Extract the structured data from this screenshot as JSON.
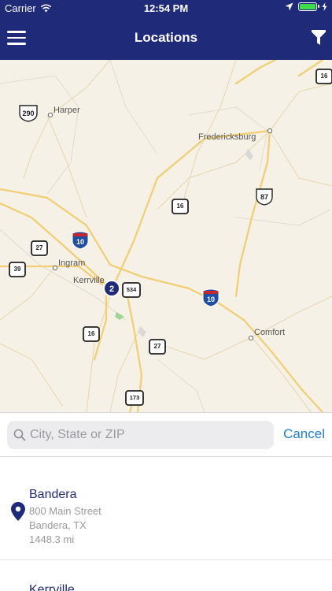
{
  "status_bar": {
    "carrier": "Carrier",
    "time": "12:54 PM"
  },
  "nav": {
    "title": "Locations",
    "menu_icon": "hamburger-menu-icon",
    "filter_icon": "filter-funnel-icon"
  },
  "map": {
    "places": [
      "Harper",
      "Fredericksburg",
      "Ingram",
      "Kerrville",
      "Comfort"
    ],
    "cluster_count": "2",
    "shields": [
      "290",
      "16",
      "16",
      "87",
      "27",
      "10",
      "39",
      "534",
      "10",
      "16",
      "27",
      "173"
    ]
  },
  "search": {
    "placeholder": "City, State or ZIP",
    "value": "",
    "cancel_label": "Cancel"
  },
  "results": [
    {
      "name": "Bandera",
      "address": "800 Main Street",
      "city_state": "Bandera, TX",
      "distance": "1448.3 mi"
    },
    {
      "name": "Kerrville"
    }
  ],
  "colors": {
    "nav_bg": "#1f2a78",
    "accent_blue": "#1c7cd6",
    "map_bg": "#f6f1e6",
    "road": "#f1cf73"
  }
}
